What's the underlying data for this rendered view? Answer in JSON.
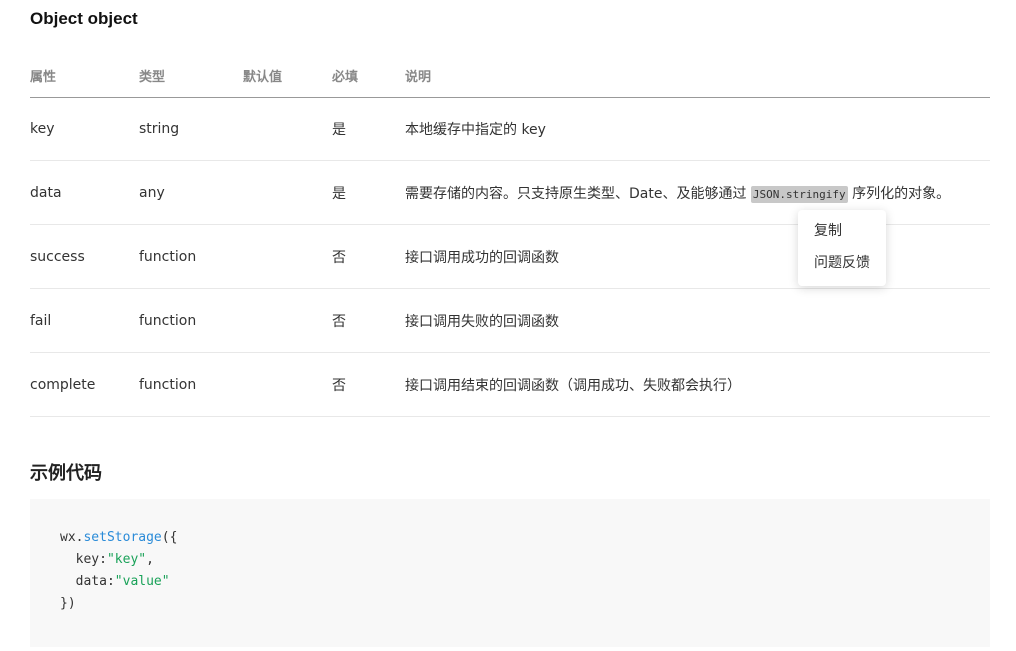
{
  "section_title": "Object object",
  "table": {
    "headers": [
      "属性",
      "类型",
      "默认值",
      "必填",
      "说明"
    ],
    "rows": [
      {
        "name": "key",
        "type": "string",
        "default": "",
        "required": "是",
        "desc": "本地缓存中指定的 key"
      },
      {
        "name": "data",
        "type": "any",
        "default": "",
        "required": "是",
        "desc_before": "需要存储的内容。只支持原生类型、Date、及能够通过 ",
        "desc_code": "JSON.stringify",
        "desc_after": " 序列化的对象。"
      },
      {
        "name": "success",
        "type": "function",
        "default": "",
        "required": "否",
        "desc": "接口调用成功的回调函数"
      },
      {
        "name": "fail",
        "type": "function",
        "default": "",
        "required": "否",
        "desc": "接口调用失败的回调函数"
      },
      {
        "name": "complete",
        "type": "function",
        "default": "",
        "required": "否",
        "desc": "接口调用结束的回调函数（调用成功、失败都会执行）"
      }
    ]
  },
  "context_menu": {
    "items": [
      "复制",
      "问题反馈"
    ]
  },
  "example": {
    "title": "示例代码",
    "code": {
      "obj": "wx",
      "dot": ".",
      "method": "setStorage",
      "open": "({",
      "key_label": "key:",
      "key_value": "\"key\"",
      "data_label": "data:",
      "data_value": "\"value\"",
      "comma": ",",
      "close": "})"
    }
  },
  "colors": {
    "code_method": "#2a8bd8",
    "code_string": "#1aa259",
    "inline_code_bg": "#c8c8c8",
    "code_block_bg": "#f8f8f8"
  }
}
